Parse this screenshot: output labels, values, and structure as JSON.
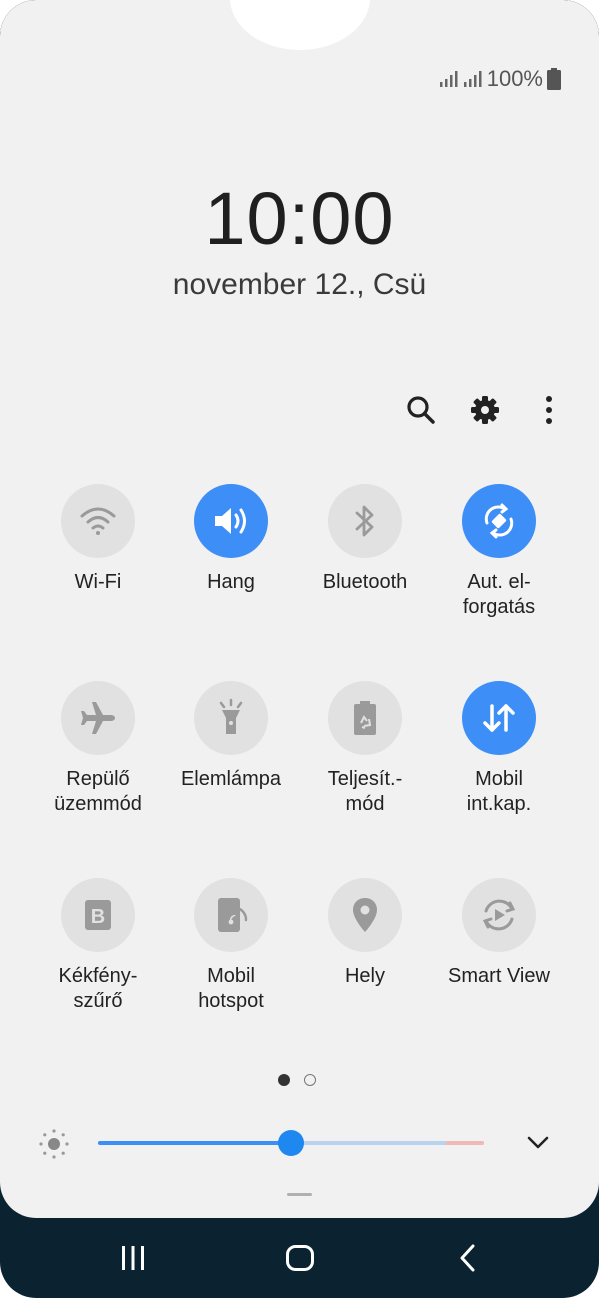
{
  "status": {
    "battery": "100%",
    "icons": [
      "signal-icon",
      "signal-icon",
      "battery-icon"
    ]
  },
  "lock": {
    "time": "10:00",
    "date": "november 12., Csü"
  },
  "toolbar": {
    "icons": [
      "search-icon",
      "settings-icon",
      "more-options-icon"
    ]
  },
  "tiles": [
    {
      "label": "Wi-Fi",
      "icon": "wifi-icon",
      "on": false
    },
    {
      "label": "Hang",
      "icon": "sound-icon",
      "on": true
    },
    {
      "label": "Bluetooth",
      "icon": "bluetooth-icon",
      "on": false
    },
    {
      "label": "Aut. el-\nforgatás",
      "icon": "auto-rotate-icon",
      "on": true
    },
    {
      "label": "Repülő\nüzemmód",
      "icon": "airplane-icon",
      "on": false
    },
    {
      "label": "Elemlámpa",
      "icon": "flashlight-icon",
      "on": false
    },
    {
      "label": "Teljesít.-\nmód",
      "icon": "power-mode-icon",
      "on": false
    },
    {
      "label": "Mobil\nint.kap.",
      "icon": "mobile-data-icon",
      "on": true
    },
    {
      "label": "Kékfény-\nszűrő",
      "icon": "blue-light-filter-icon",
      "on": false
    },
    {
      "label": "Mobil\nhotspot",
      "icon": "hotspot-icon",
      "on": false
    },
    {
      "label": "Hely",
      "icon": "location-icon",
      "on": false
    },
    {
      "label": "Smart View",
      "icon": "smart-view-icon",
      "on": false
    }
  ],
  "pagination": {
    "pages": 2,
    "current": 1
  },
  "brightness": {
    "level": 0.5,
    "icon": "brightness-icon",
    "expand_icon": "chevron-down-icon"
  },
  "colors": {
    "accent": "#3d8ef6",
    "panel": "#f1f1f1",
    "tile_off": "#e1e1e1",
    "navbar": "#0b2230"
  },
  "navbar": {
    "icons": [
      "recents-icon",
      "home-icon",
      "back-icon"
    ]
  }
}
